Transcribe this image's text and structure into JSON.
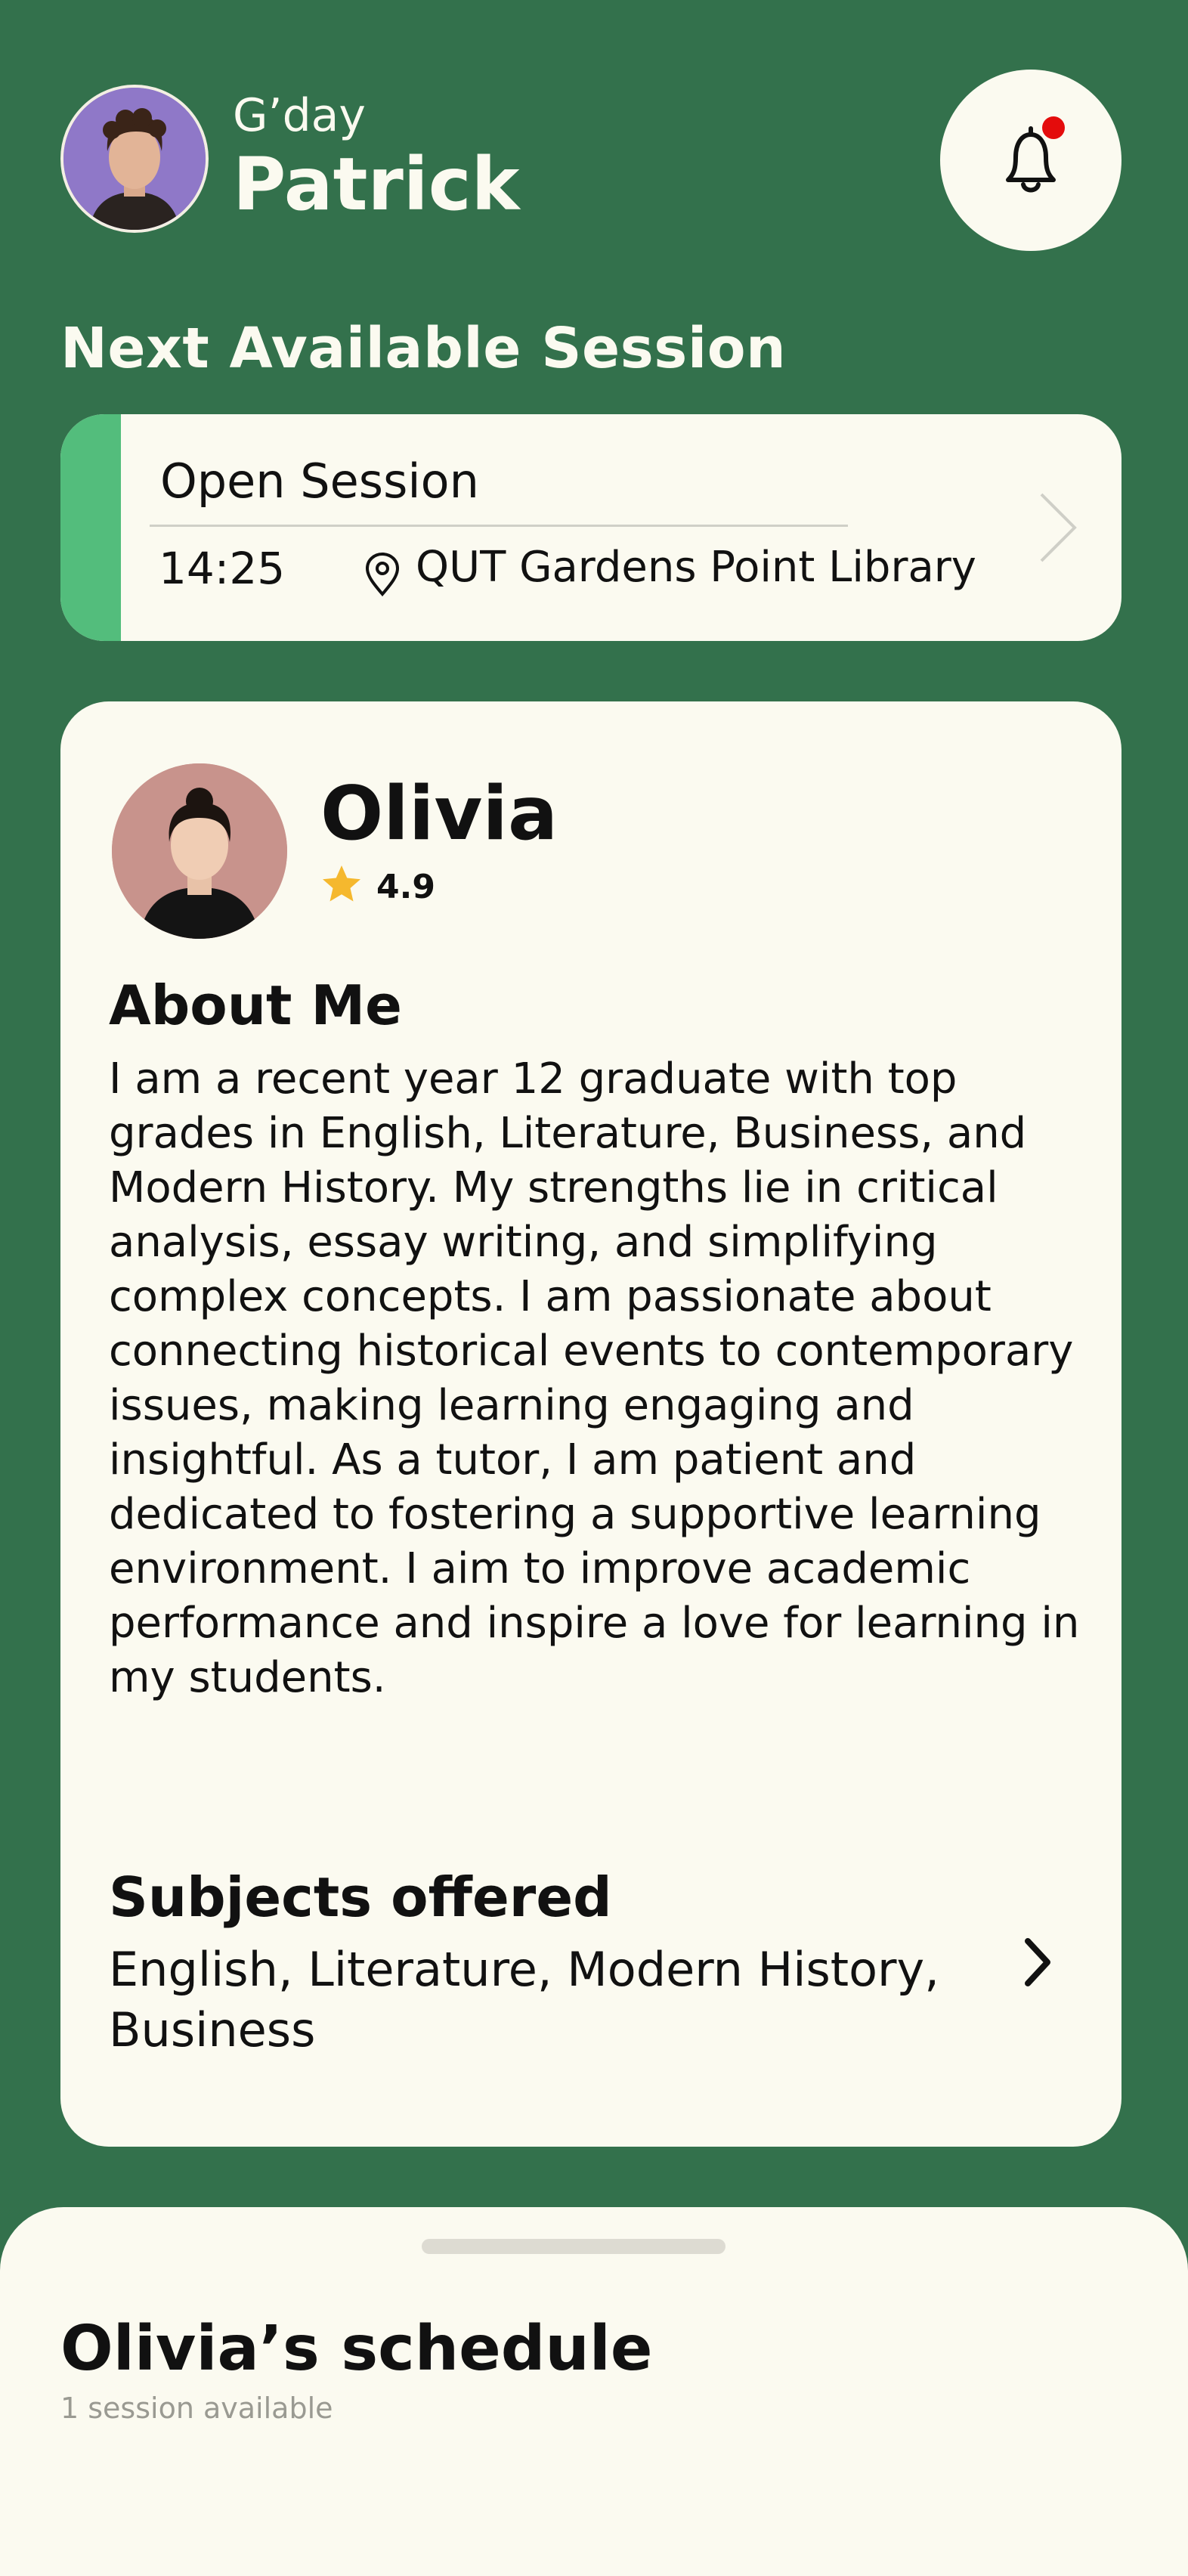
{
  "header": {
    "greeting": "G’day",
    "user_name": "Patrick"
  },
  "notifications": {
    "has_unread": true
  },
  "next_session": {
    "heading": "Next Available Session",
    "type": "Open Session",
    "time": "14:25",
    "location": "QUT Gardens Point Library"
  },
  "tutor": {
    "name": "Olivia",
    "rating": "4.9",
    "about_title": "About Me",
    "about_text": "I am a recent year 12 graduate with top grades in English, Literature, Business, and Modern History. My strengths lie in critical analysis, essay writing, and simplifying complex concepts. I am passionate about connecting historical events to contemporary issues, making learning engaging and insightful. As a tutor, I am patient and dedicated to fostering a supportive learning environment. I aim to improve academic performance and inspire a love for learning in my students.",
    "subjects_title": "Subjects offered",
    "subjects_text": "English, Literature, Modern History, Business"
  },
  "schedule": {
    "title": "Olivia’s schedule",
    "subtitle": "1 session available"
  },
  "colors": {
    "background": "#33714c",
    "card": "#fbfaf0",
    "accent": "#53bd7c",
    "notification_dot": "#e40c0c",
    "star": "#f5b82e"
  }
}
